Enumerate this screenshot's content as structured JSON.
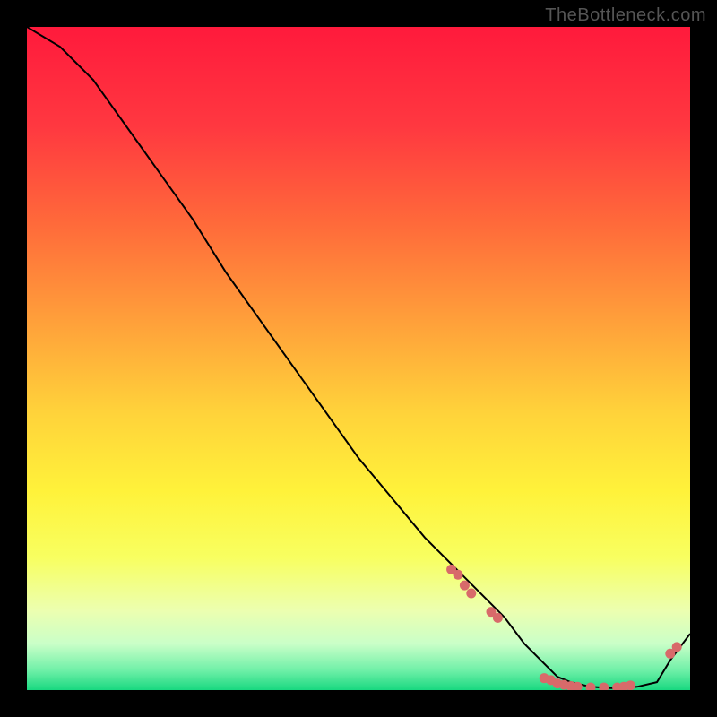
{
  "watermark": "TheBottleneck.com",
  "chart_data": {
    "type": "line",
    "title": "",
    "xlabel": "",
    "ylabel": "",
    "xlim": [
      0,
      100
    ],
    "ylim": [
      0,
      100
    ],
    "grid": false,
    "legend": false,
    "background": {
      "type": "vertical-gradient",
      "stops": [
        {
          "pos": 0.0,
          "color": "#ff1a3c"
        },
        {
          "pos": 0.15,
          "color": "#ff3840"
        },
        {
          "pos": 0.3,
          "color": "#ff6b3a"
        },
        {
          "pos": 0.45,
          "color": "#ffa23a"
        },
        {
          "pos": 0.58,
          "color": "#ffd23a"
        },
        {
          "pos": 0.7,
          "color": "#fff23a"
        },
        {
          "pos": 0.8,
          "color": "#f8ff60"
        },
        {
          "pos": 0.88,
          "color": "#ecffb0"
        },
        {
          "pos": 0.93,
          "color": "#caffc8"
        },
        {
          "pos": 0.97,
          "color": "#70f0a8"
        },
        {
          "pos": 1.0,
          "color": "#18d880"
        }
      ]
    },
    "series": [
      {
        "name": "bottleneck-curve",
        "stroke": "#000000",
        "stroke_width": 2,
        "x": [
          0,
          5,
          10,
          15,
          20,
          25,
          30,
          35,
          40,
          45,
          50,
          55,
          60,
          65,
          70,
          72,
          75,
          78,
          80,
          82,
          85,
          88,
          90,
          92,
          95,
          97,
          100
        ],
        "y": [
          100,
          97,
          92,
          85,
          78,
          71,
          63,
          56,
          49,
          42,
          35,
          29,
          23,
          18,
          13,
          11,
          7,
          4,
          2,
          1.2,
          0.5,
          0.3,
          0.3,
          0.5,
          1.2,
          4.5,
          8.5
        ]
      }
    ],
    "markers": {
      "name": "dots",
      "color": "#d86a6a",
      "radius": 5.5,
      "points": [
        {
          "x": 64,
          "y": 18.2
        },
        {
          "x": 65,
          "y": 17.4
        },
        {
          "x": 66,
          "y": 15.8
        },
        {
          "x": 67,
          "y": 14.6
        },
        {
          "x": 70,
          "y": 11.8
        },
        {
          "x": 71,
          "y": 10.9
        },
        {
          "x": 78,
          "y": 1.8
        },
        {
          "x": 79,
          "y": 1.5
        },
        {
          "x": 80,
          "y": 1.0
        },
        {
          "x": 81,
          "y": 0.8
        },
        {
          "x": 82,
          "y": 0.6
        },
        {
          "x": 83,
          "y": 0.5
        },
        {
          "x": 85,
          "y": 0.4
        },
        {
          "x": 87,
          "y": 0.4
        },
        {
          "x": 89,
          "y": 0.4
        },
        {
          "x": 90,
          "y": 0.5
        },
        {
          "x": 91,
          "y": 0.7
        },
        {
          "x": 97,
          "y": 5.5
        },
        {
          "x": 98,
          "y": 6.5
        }
      ]
    }
  }
}
